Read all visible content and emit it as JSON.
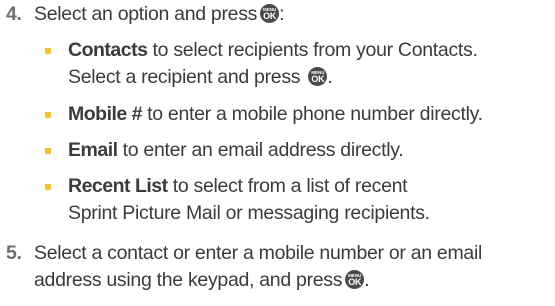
{
  "step4": {
    "number": "4.",
    "text": "Select an option and press",
    "suffix": ":"
  },
  "options": [
    {
      "term": "Contacts",
      "line1": " to select recipients from your Contacts.",
      "line2": "Select a recipient and press",
      "line2_suffix": "."
    },
    {
      "term": "Mobile #",
      "line1": " to enter a mobile phone number directly."
    },
    {
      "term": "Email",
      "line1": " to enter an email address directly."
    },
    {
      "term": "Recent List",
      "line1": " to select from a list of recent",
      "line2": "Sprint Picture Mail or messaging recipients."
    }
  ],
  "step5": {
    "number": "5.",
    "line1": "Select a contact or enter a mobile number or an email",
    "line2": "address using the keypad, and press",
    "suffix": "."
  },
  "key": {
    "top": "MENU",
    "bottom": "OK",
    "icon": "menu-ok-key-icon"
  },
  "colors": {
    "text": "#3b3b3b",
    "step_number": "#6f6f6f",
    "bullet": "#f3c230",
    "key_bg": "#4a4a4a"
  }
}
